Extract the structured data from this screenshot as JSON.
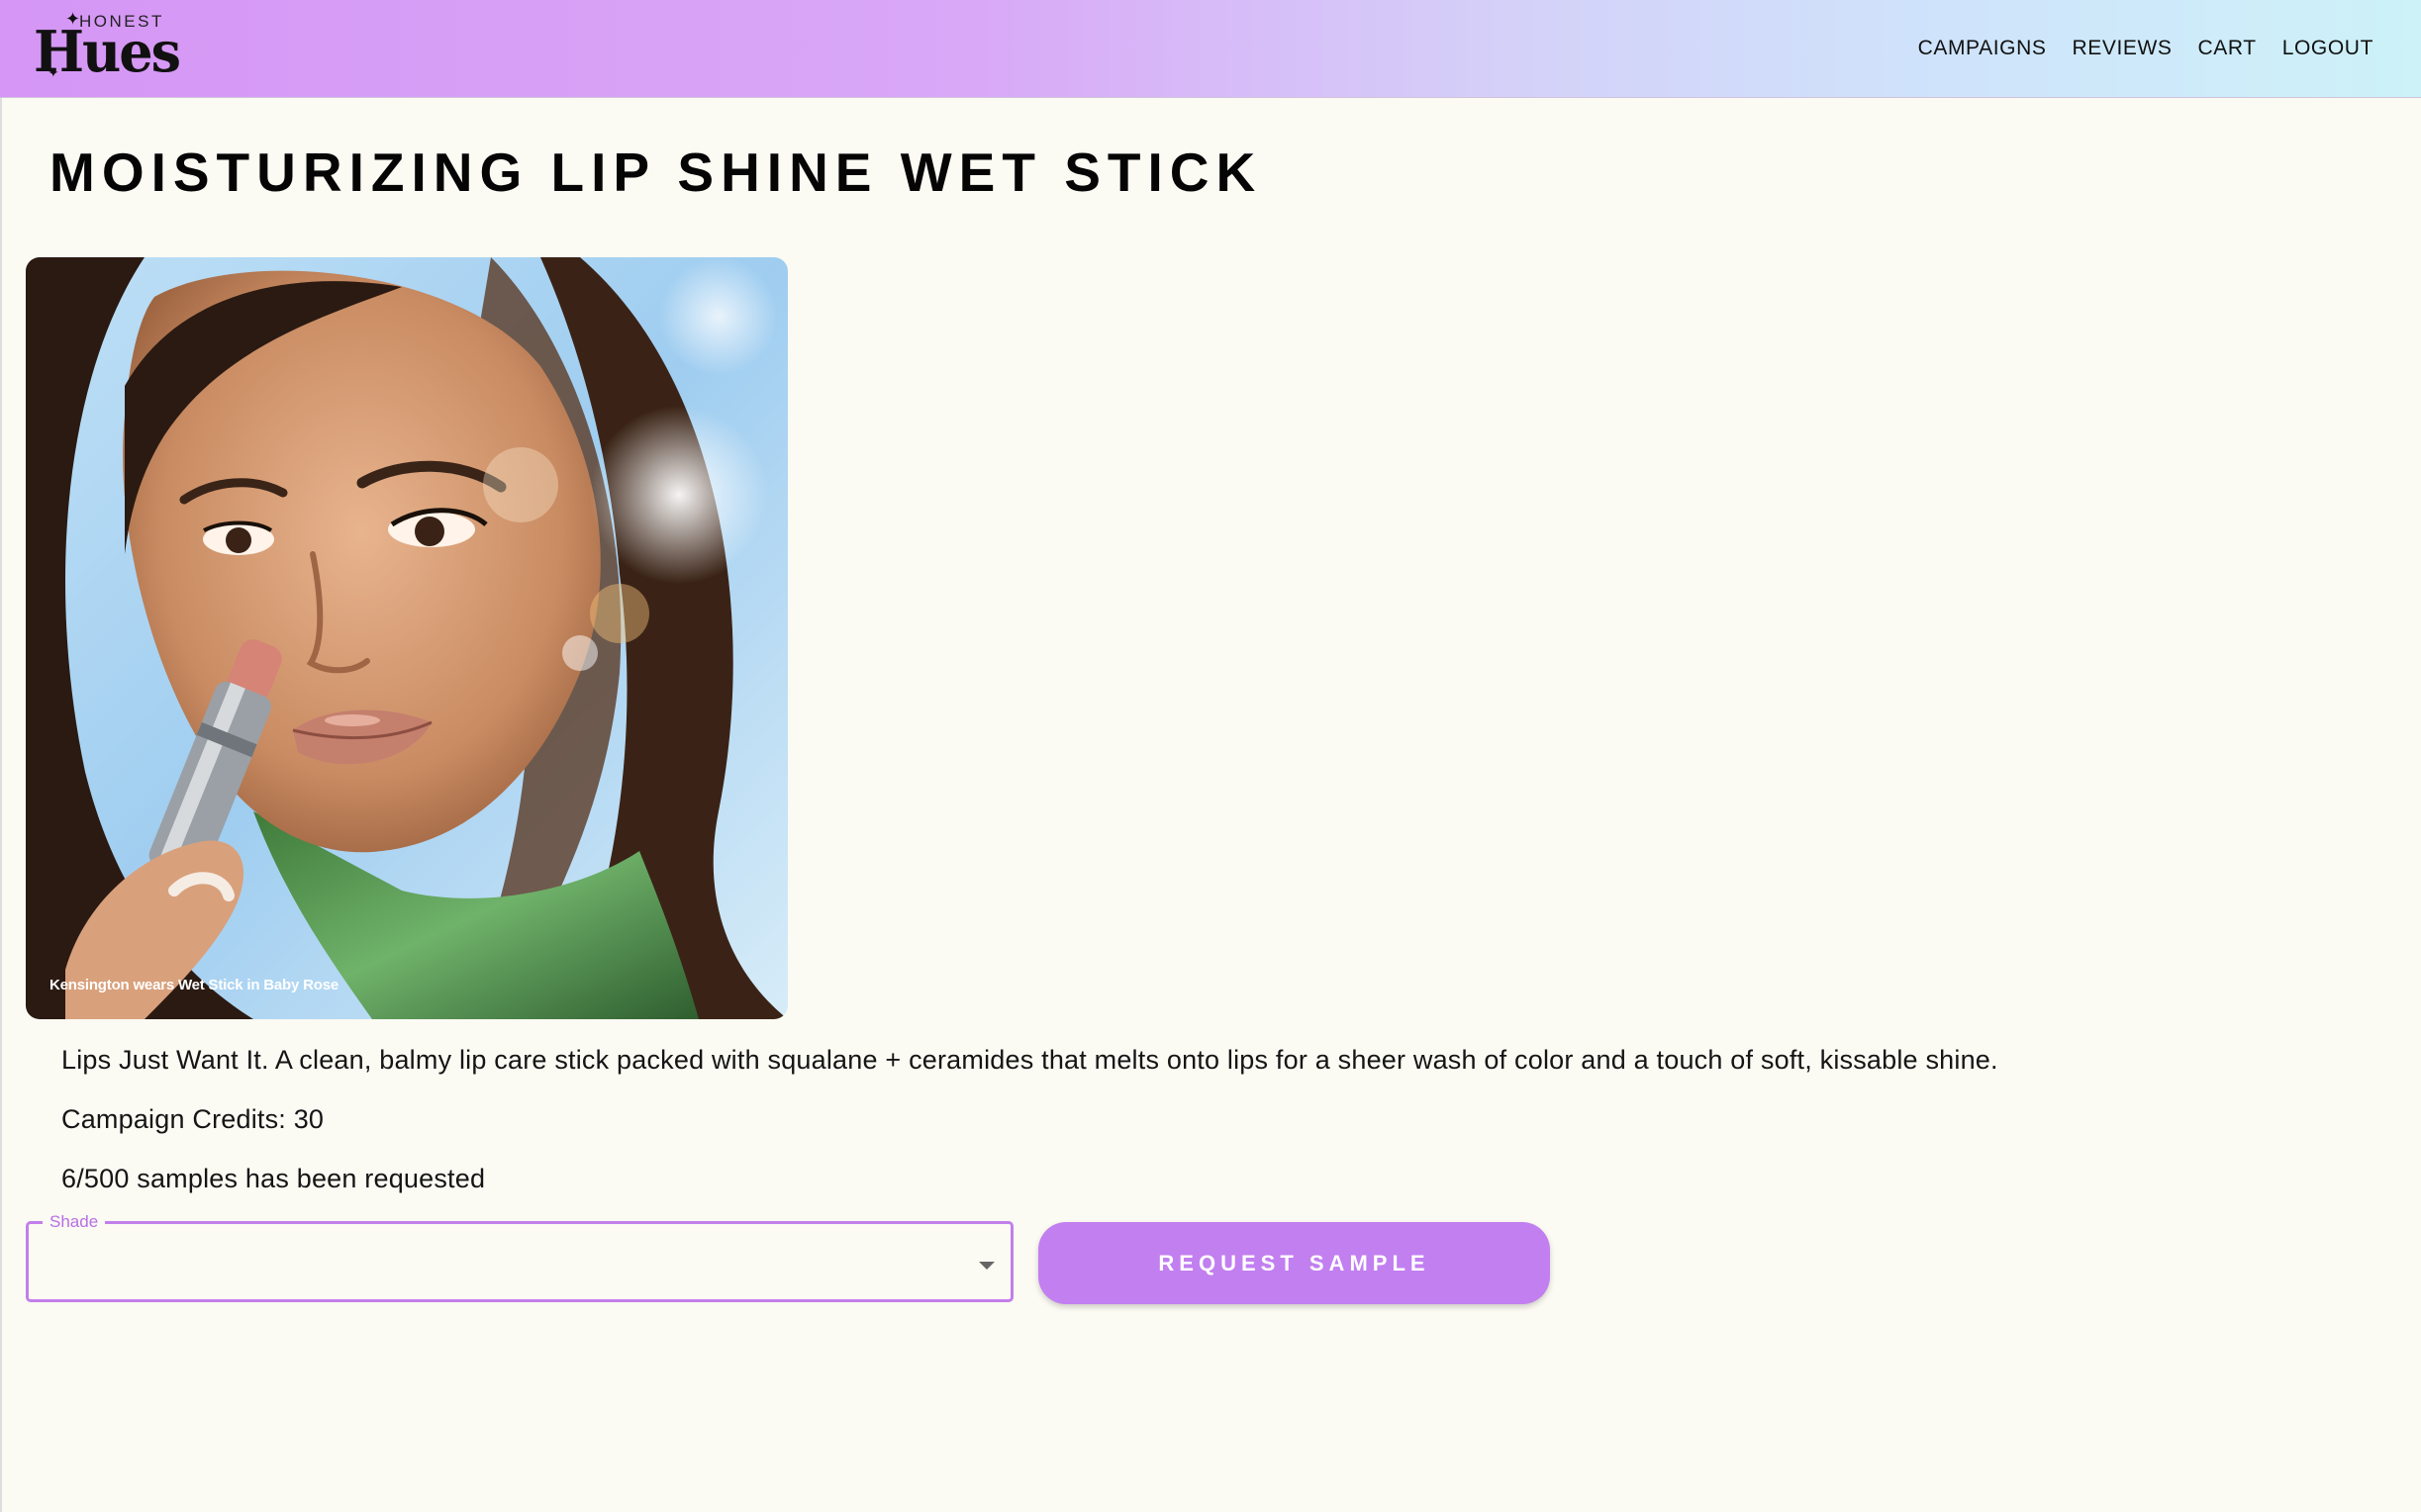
{
  "header": {
    "logo_small": "HONEST",
    "logo_big": "Hues",
    "nav": [
      {
        "label": "CAMPAIGNS"
      },
      {
        "label": "REVIEWS"
      },
      {
        "label": "CART"
      },
      {
        "label": "LOGOUT"
      }
    ]
  },
  "product": {
    "title": "MOISTURIZING LIP SHINE WET STICK",
    "image_caption": "Kensington wears Wet Stick in Baby Rose",
    "description": "Lips Just Want It. A clean, balmy lip care stick packed with squalane + ceramides that melts onto lips for a sheer wash of color and a touch of soft, kissable shine.",
    "credits": "Campaign Credits: 30",
    "samples": "6/500 samples has been requested"
  },
  "form": {
    "shade_label": "Shade",
    "shade_value": "",
    "request_button": "REQUEST SAMPLE"
  },
  "colors": {
    "accent": "#c27ff0",
    "page_background": "#fbfaf3"
  }
}
